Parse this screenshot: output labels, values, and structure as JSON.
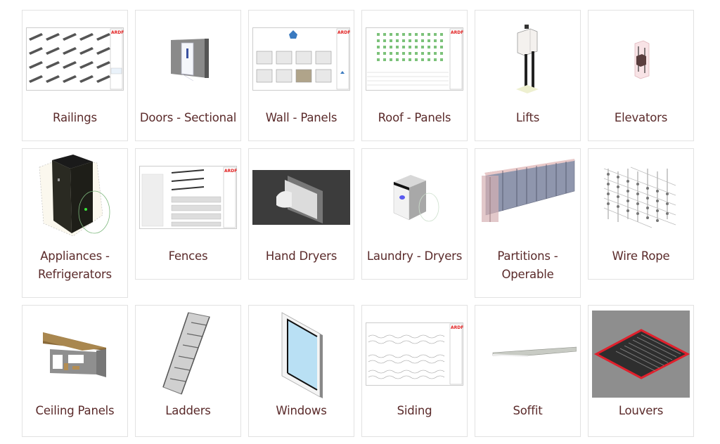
{
  "colors": {
    "label_text": "#5a2a2a",
    "card_border": "#e2e2e2",
    "brand_logo_red": "#e02020"
  },
  "categories": [
    {
      "label": "Railings",
      "thumbnail": "railings-sheet-drawing"
    },
    {
      "label": "Doors - Sectional",
      "thumbnail": "sectional-door-model"
    },
    {
      "label": "Wall - Panels",
      "thumbnail": "wall-panels-sheet-drawing"
    },
    {
      "label": "Roof - Panels",
      "thumbnail": "roof-panels-sheet-drawing"
    },
    {
      "label": "Lifts",
      "thumbnail": "lift-model"
    },
    {
      "label": "Elevators",
      "thumbnail": "elevator-model"
    },
    {
      "label": "Appliances - Refrigerators",
      "thumbnail": "refrigerator-model"
    },
    {
      "label": "Fences",
      "thumbnail": "fences-sheet-drawing"
    },
    {
      "label": "Hand Dryers",
      "thumbnail": "hand-dryer-model"
    },
    {
      "label": "Laundry - Dryers",
      "thumbnail": "laundry-dryer-model"
    },
    {
      "label": "Partitions - Operable",
      "thumbnail": "operable-partition-model"
    },
    {
      "label": "Wire Rope",
      "thumbnail": "wire-rope-mesh-model"
    },
    {
      "label": "Ceiling Panels",
      "thumbnail": "ceiling-panels-model"
    },
    {
      "label": "Ladders",
      "thumbnail": "ladder-model"
    },
    {
      "label": "Windows",
      "thumbnail": "window-model"
    },
    {
      "label": "Siding",
      "thumbnail": "siding-sheet-drawing"
    },
    {
      "label": "Soffit",
      "thumbnail": "soffit-model"
    },
    {
      "label": "Louvers",
      "thumbnail": "louver-model"
    }
  ]
}
